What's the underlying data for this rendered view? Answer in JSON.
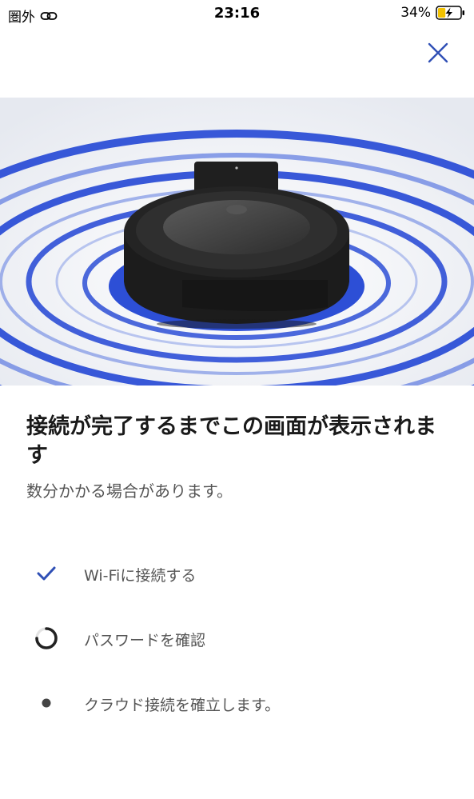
{
  "status_bar": {
    "carrier": "圏外",
    "time": "23:16",
    "battery_percent": "34%",
    "battery_level": 0.34,
    "icons": [
      "link-icon",
      "battery-charging-icon"
    ]
  },
  "header": {
    "close_icon": "close-icon"
  },
  "hero": {
    "image": "robot-vacuum-illustration",
    "accent_color": "#2d4fd6"
  },
  "content": {
    "title": "接続が完了するまでこの画面が表示されます",
    "subtitle": "数分かかる場合があります。"
  },
  "steps": [
    {
      "label": "Wi-Fiに接続する",
      "state": "done",
      "icon": "checkmark-icon"
    },
    {
      "label": "パスワードを確認",
      "state": "in-progress",
      "icon": "spinner-icon"
    },
    {
      "label": "クラウド接続を確立します。",
      "state": "pending",
      "icon": "dot-icon"
    }
  ],
  "colors": {
    "check": "#2f4fb5",
    "text_secondary": "#555555",
    "title": "#1a1a1a"
  }
}
